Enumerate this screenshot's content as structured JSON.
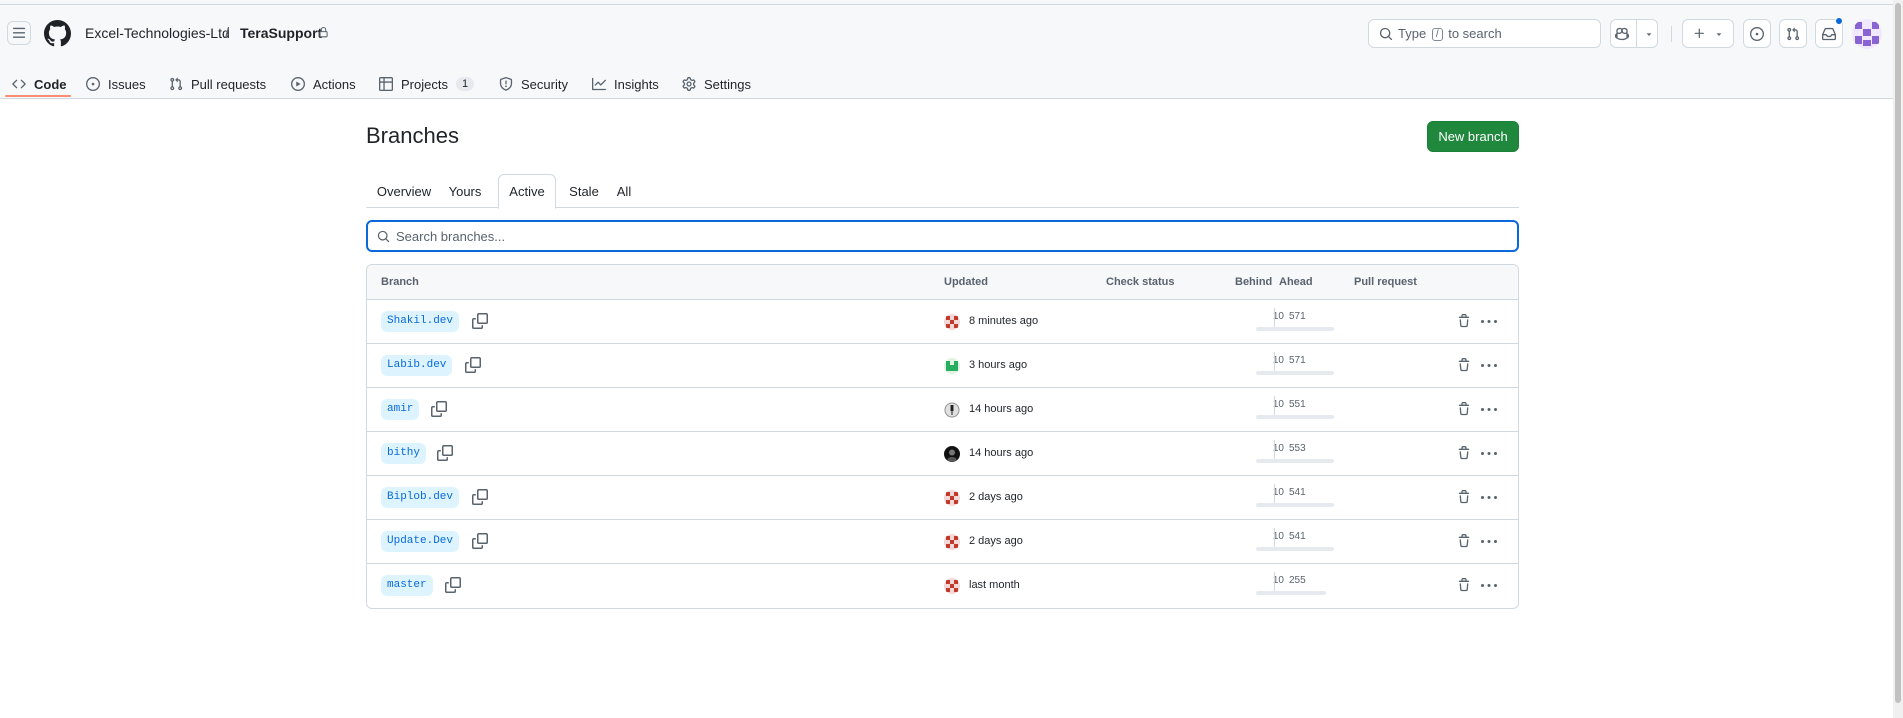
{
  "header": {
    "owner": "Excel-Technologies-Ltd",
    "separator": "/",
    "repo": "TeraSupport",
    "search_prefix": "Type",
    "search_key": "/",
    "search_suffix": "to search"
  },
  "nav": {
    "code": "Code",
    "issues": "Issues",
    "pull_requests": "Pull requests",
    "actions": "Actions",
    "projects": "Projects",
    "projects_count": "1",
    "security": "Security",
    "insights": "Insights",
    "settings": "Settings"
  },
  "page": {
    "title": "Branches",
    "new_branch": "New branch"
  },
  "tabs": {
    "overview": "Overview",
    "yours": "Yours",
    "active": "Active",
    "stale": "Stale",
    "all": "All"
  },
  "search": {
    "placeholder": "Search branches..."
  },
  "table": {
    "headers": {
      "branch": "Branch",
      "updated": "Updated",
      "check_status": "Check status",
      "behind": "Behind",
      "ahead": "Ahead",
      "pull_request": "Pull request"
    },
    "rows": [
      {
        "name": "Shakil.dev",
        "updated": "8 minutes ago",
        "behind": "10",
        "ahead": "571"
      },
      {
        "name": "Labib.dev",
        "updated": "3 hours ago",
        "behind": "10",
        "ahead": "571"
      },
      {
        "name": "amir",
        "updated": "14 hours ago",
        "behind": "10",
        "ahead": "551"
      },
      {
        "name": "bithy",
        "updated": "14 hours ago",
        "behind": "10",
        "ahead": "553"
      },
      {
        "name": "Biplob.dev",
        "updated": "2 days ago",
        "behind": "10",
        "ahead": "541"
      },
      {
        "name": "Update.Dev",
        "updated": "2 days ago",
        "behind": "10",
        "ahead": "541"
      },
      {
        "name": "master",
        "updated": "last month",
        "behind": "10",
        "ahead": "255"
      }
    ]
  },
  "colors": {
    "accent": "#0969da",
    "primary_button": "#1f883d",
    "nav_underline": "#fd8c73"
  },
  "icons": [
    "hamburger-icon",
    "github-logo-icon",
    "lock-icon",
    "search-icon",
    "copilot-icon",
    "plus-icon",
    "issue-icon",
    "pull-request-icon",
    "inbox-icon",
    "copy-icon",
    "trash-icon",
    "kebab-icon"
  ]
}
